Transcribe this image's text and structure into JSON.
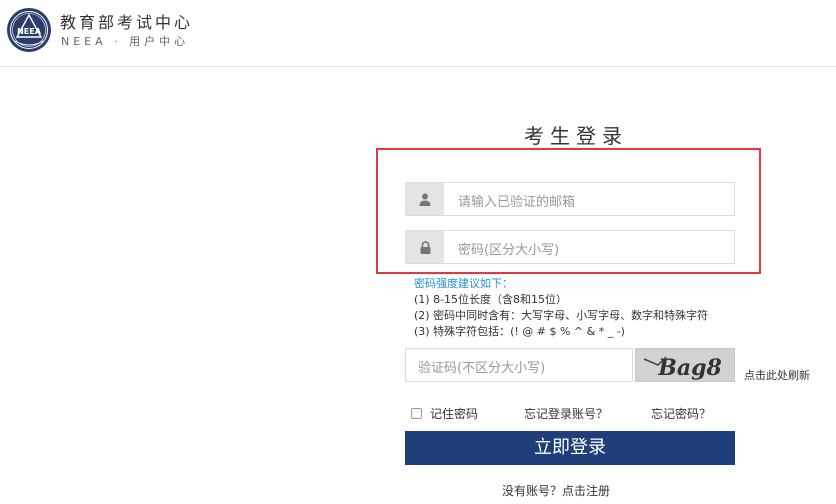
{
  "header": {
    "logo_text": "NEEA",
    "title": "教育部考试中心",
    "subtitle": "NEEA · 用户中心"
  },
  "login": {
    "title": "考生登录",
    "email_placeholder": "请输入已验证的邮箱",
    "password_placeholder": "密码(区分大小写)",
    "user_icon": "user-icon",
    "lock_icon": "lock-icon"
  },
  "tips": {
    "heading": "密码强度建议如下：",
    "line1": "(1) 8-15位长度（含8和15位）",
    "line2": "(2) 密码中同时含有：大写字母、小写字母、数字和特殊字符",
    "line3": "(3) 特殊字符包括：(! @ # $ % ^ & * _ -)"
  },
  "captcha": {
    "placeholder": "验证码(不区分大小写)",
    "image_text": "Bag8",
    "refresh_label": "点击此处刷新"
  },
  "options": {
    "remember_label": "记住密码",
    "forgot_account": "忘记登录账号？",
    "forgot_password": "忘记密码？"
  },
  "submit_label": "立即登录",
  "register_label": "没有账号？点击注册",
  "colors": {
    "primary": "#1e3f7a",
    "highlight": "#e0393e",
    "tip_heading": "#1e8fd6"
  }
}
